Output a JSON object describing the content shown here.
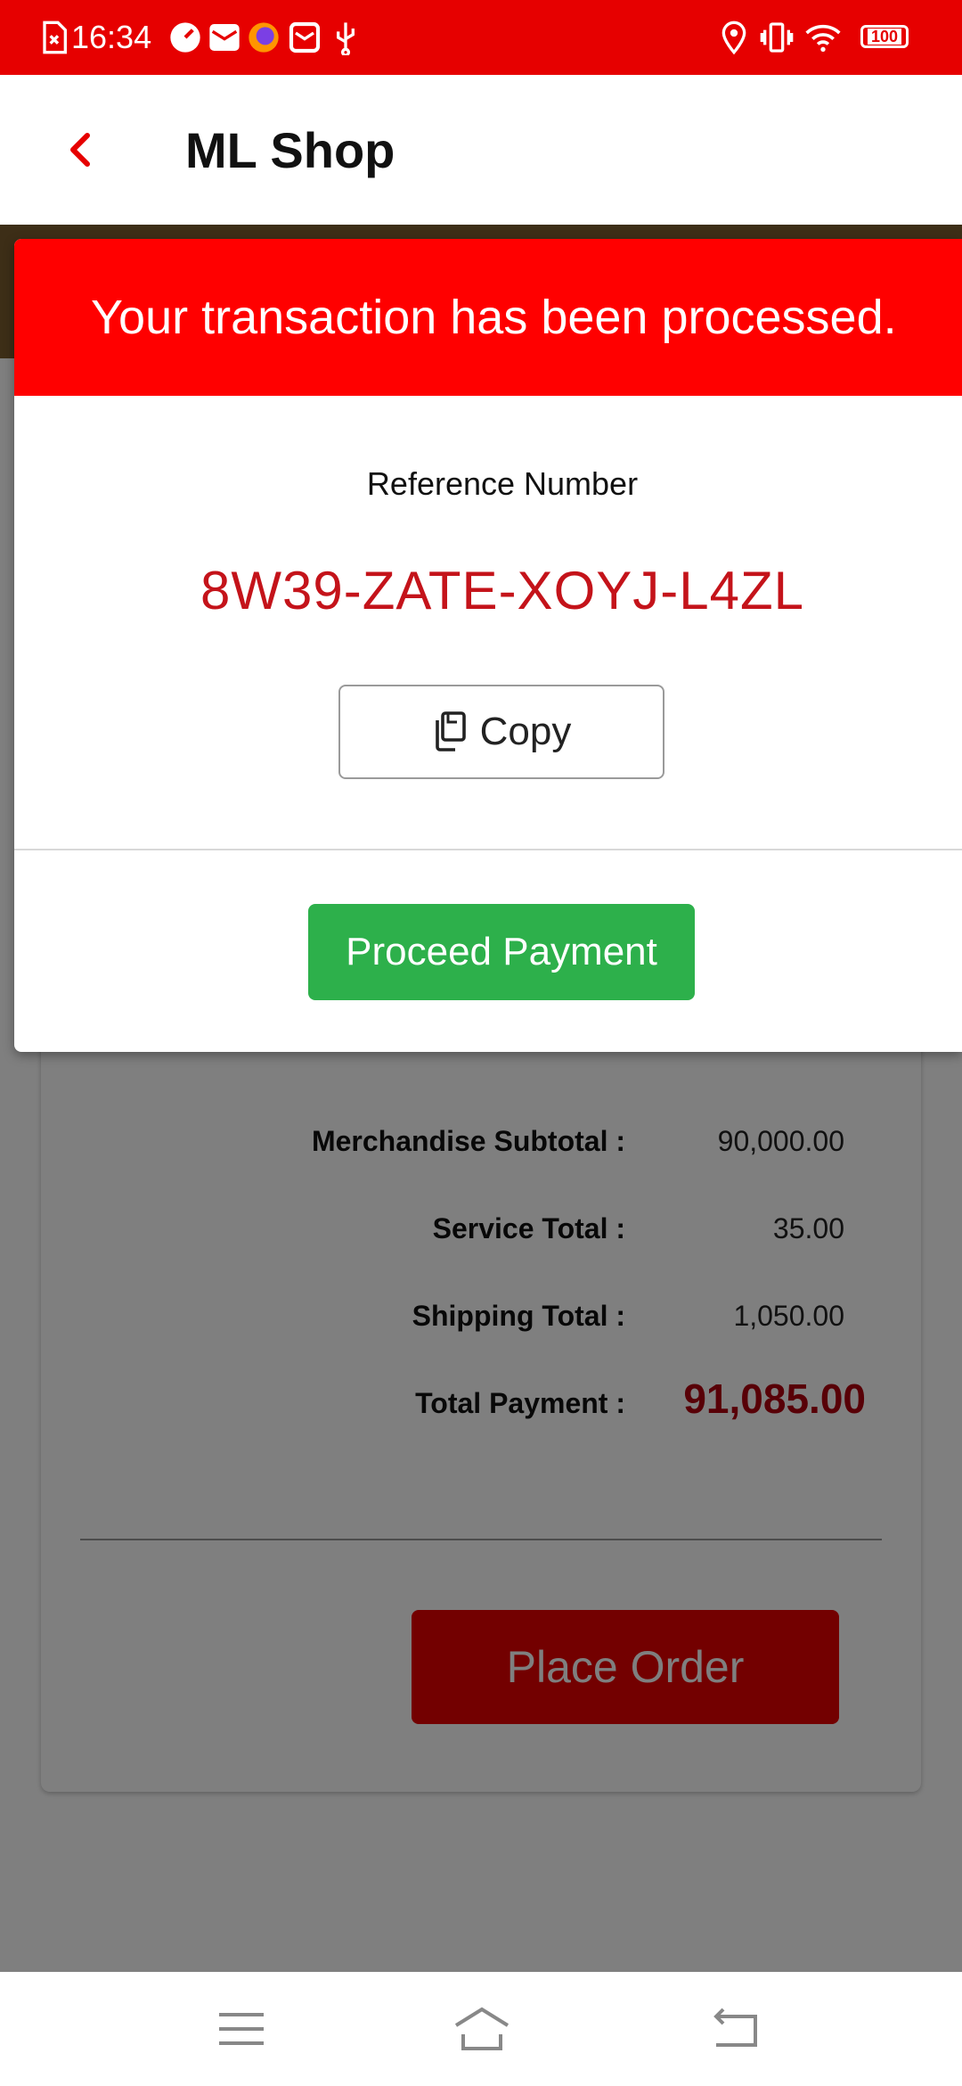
{
  "status_bar": {
    "time": "16:34",
    "battery": "100",
    "icons": [
      "sim-error-icon",
      "speedometer-icon",
      "mail-icon",
      "firefox-icon",
      "inbox-icon",
      "usb-icon",
      "location-icon",
      "vibrate-icon",
      "wifi-icon",
      "battery-icon"
    ]
  },
  "app_bar": {
    "title": "ML Shop",
    "back_icon": "chevron-left-icon"
  },
  "modal": {
    "header": "Your transaction has been processed.",
    "reference_label": "Reference Number",
    "reference_number": "8W39-ZATE-XOYJ-L4ZL",
    "copy_label": "Copy",
    "proceed_label": "Proceed Payment"
  },
  "summary": {
    "rows": [
      {
        "label": "Merchandise Subtotal :",
        "value": "90,000.00"
      },
      {
        "label": "Service Total :",
        "value": "35.00"
      },
      {
        "label": "Shipping Total :",
        "value": "1,050.00"
      },
      {
        "label": "Total Payment :",
        "value": "91,085.00"
      }
    ],
    "place_order_label": "Place Order"
  },
  "nav_bar": {
    "icons": [
      "menu-icon",
      "home-icon",
      "back-icon"
    ]
  },
  "colors": {
    "brand_red": "#e60000",
    "modal_header": "#ff0000",
    "reference_text": "#c4131a",
    "proceed_green": "#2db04b",
    "total_red": "#b0000f"
  }
}
